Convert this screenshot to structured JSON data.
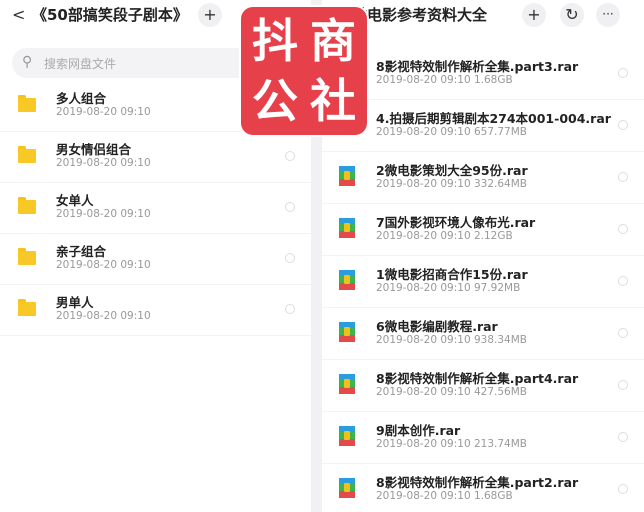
{
  "left": {
    "back": "<",
    "title": "《50部搞笑段子剧本》",
    "plus": "+",
    "search_placeholder": "搜索网盘文件",
    "items": [
      {
        "name": "多人组合",
        "meta": "2019-08-20  09:10"
      },
      {
        "name": "男女情侣组合",
        "meta": "2019-08-20  09:10"
      },
      {
        "name": "女单人",
        "meta": "2019-08-20  09:10"
      },
      {
        "name": "亲子组合",
        "meta": "2019-08-20  09:10"
      },
      {
        "name": "男单人",
        "meta": "2019-08-20  09:10"
      }
    ]
  },
  "right": {
    "back": "<",
    "title": "微电影参考资料大全",
    "plus": "+",
    "refresh": "↻",
    "more": "···",
    "items": [
      {
        "name": "8影视特效制作解析全集.part3.rar",
        "meta": "2019-08-20  09:10  1.68GB"
      },
      {
        "name": "4.拍摄后期剪辑剧本274本001-004.rar",
        "meta": "2019-08-20  09:10  657.77MB"
      },
      {
        "name": "2微电影策划大全95份.rar",
        "meta": "2019-08-20  09:10  332.64MB"
      },
      {
        "name": "7国外影视环境人像布光.rar",
        "meta": "2019-08-20  09:10  2.12GB"
      },
      {
        "name": "1微电影招商合作15份.rar",
        "meta": "2019-08-20  09:10  97.92MB"
      },
      {
        "name": "6微电影编剧教程.rar",
        "meta": "2019-08-20  09:10  938.34MB"
      },
      {
        "name": "8影视特效制作解析全集.part4.rar",
        "meta": "2019-08-20  09:10  427.56MB"
      },
      {
        "name": "9剧本创作.rar",
        "meta": "2019-08-20  09:10  213.74MB"
      },
      {
        "name": "8影视特效制作解析全集.part2.rar",
        "meta": "2019-08-20  09:10  1.68GB"
      }
    ]
  },
  "overlay_logo": [
    "抖",
    "商",
    "公",
    "社"
  ],
  "colors": {
    "accent_logo": "#e6404a",
    "folder": "#f8c826",
    "divider": "#f1f1f3"
  }
}
